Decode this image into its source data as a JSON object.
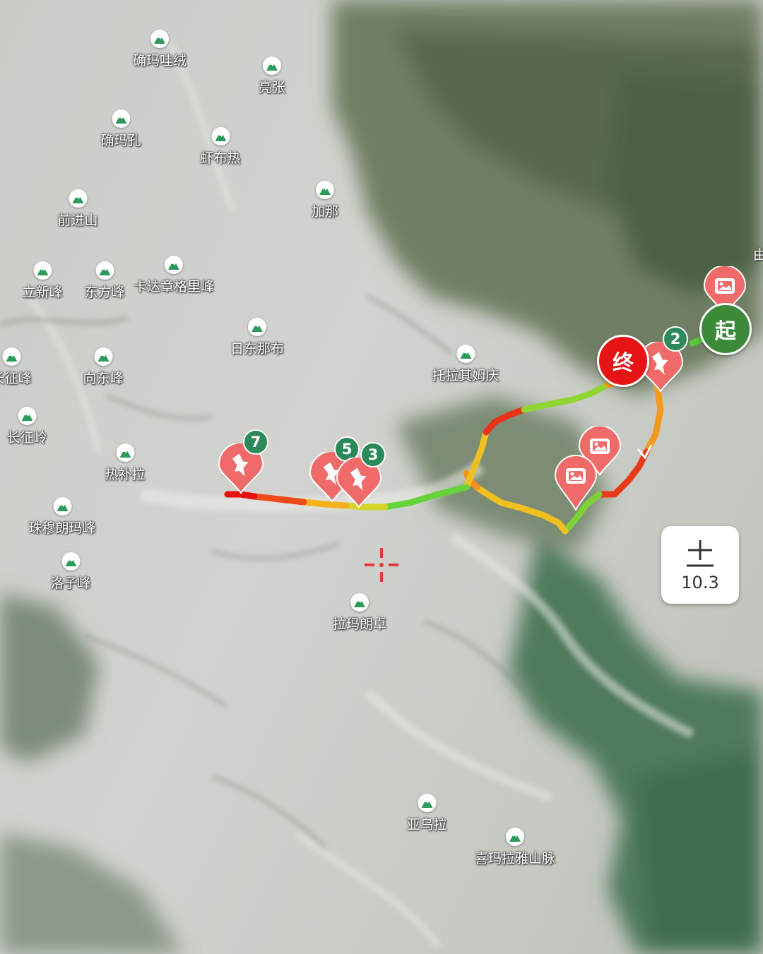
{
  "map": {
    "peaks": [
      {
        "id": "peak-1",
        "label": "确玛哇绒"
      },
      {
        "id": "peak-2",
        "label": "亮张"
      },
      {
        "id": "peak-3",
        "label": "确玛孔"
      },
      {
        "id": "peak-4",
        "label": "虾布热"
      },
      {
        "id": "peak-5",
        "label": "前进山"
      },
      {
        "id": "peak-6",
        "label": "加那"
      },
      {
        "id": "peak-7",
        "label": "卡达章格里峰"
      },
      {
        "id": "peak-8",
        "label": "立新峰"
      },
      {
        "id": "peak-9",
        "label": "东方峰"
      },
      {
        "id": "peak-10",
        "label": "日东那布"
      },
      {
        "id": "peak-11",
        "label": "托拉其姆庆"
      },
      {
        "id": "peak-12",
        "label": "长征峰"
      },
      {
        "id": "peak-13",
        "label": "向东峰"
      },
      {
        "id": "peak-14",
        "label": "长征岭"
      },
      {
        "id": "peak-15",
        "label": "热补拉"
      },
      {
        "id": "peak-16",
        "label": "珠穆朗玛峰"
      },
      {
        "id": "peak-17",
        "label": "洛子峰"
      },
      {
        "id": "peak-18",
        "label": "拉玛朗卓"
      },
      {
        "id": "peak-19",
        "label": "亚乌拉"
      },
      {
        "id": "peak-20",
        "label": "喜玛拉雅山脉"
      }
    ],
    "route": {
      "start_label": "起",
      "end_label": "终",
      "waypoint_badges": [
        "2",
        "5",
        "3",
        "7"
      ]
    },
    "edge_label": "由",
    "zoom_level": "10.3",
    "colors": {
      "start": "#3a8a3a",
      "end": "#e61414",
      "marker": "#f06a6a",
      "badge": "#2c8a5a"
    },
    "icons": {
      "peak": "mountain-icon",
      "waypoint": "pushpin-icon",
      "photo": "photo-icon",
      "crosshair": "crosshair-icon",
      "zoom": "zoom-icon"
    }
  }
}
